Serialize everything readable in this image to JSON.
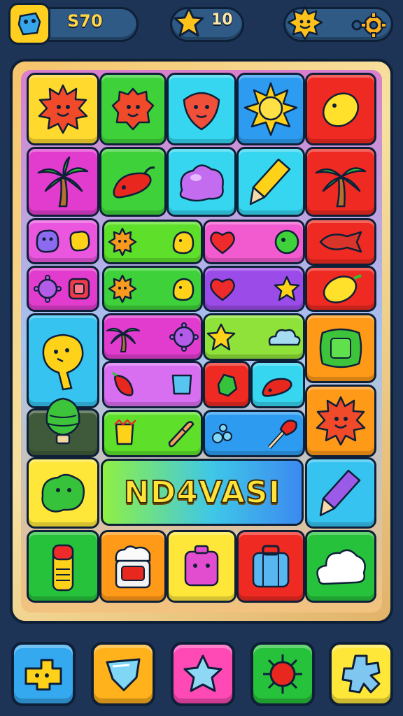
{
  "hud": {
    "coins": "S70",
    "stars": "10",
    "coin_icon": "blue-creature-icon",
    "star_icon": "star-icon",
    "sun_icon": "smiling-sun-icon",
    "settings_icon": "gear-icon"
  },
  "board": {
    "title": "ND4VASI"
  },
  "boosters": [
    {
      "icon": "blue-block-creature-icon",
      "color": "#35a9f0"
    },
    {
      "icon": "ice-crystal-icon",
      "color": "#ffb21c"
    },
    {
      "icon": "star-icon",
      "color": "#ff4ab6"
    },
    {
      "icon": "red-sun-icon",
      "color": "#27c23b"
    },
    {
      "icon": "blue-splat-icon",
      "color": "#ffe73a"
    }
  ],
  "colors": {
    "background": "#1d3457",
    "outline": "#0e1f38",
    "title": "#ffe23a"
  }
}
